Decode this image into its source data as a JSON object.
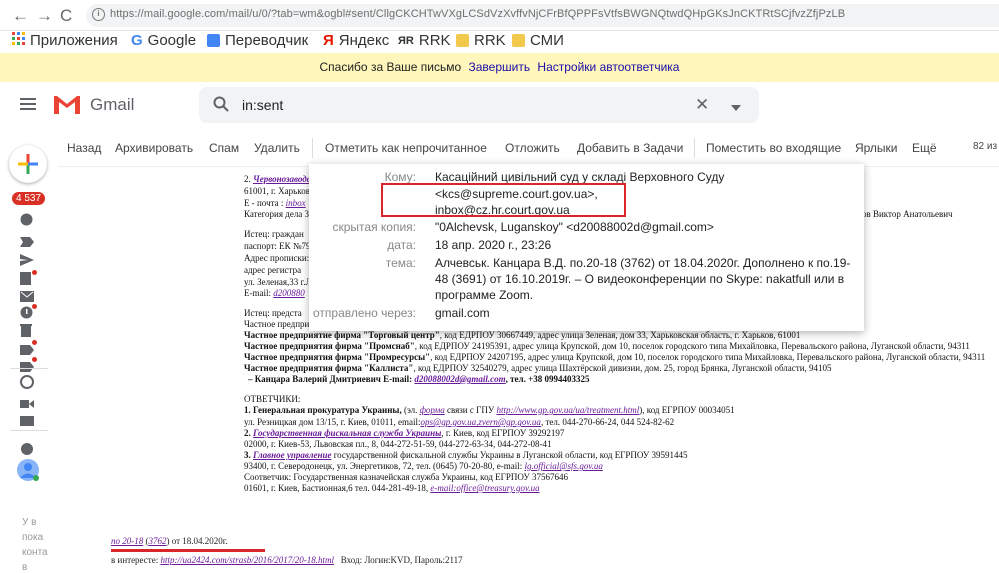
{
  "browser": {
    "url": "https://mail.google.com/mail/u/0/?tab=wm&ogbl#sent/CllgCKCHTwVXgLCSdVzXvffvNjCFrBfQPPFsVtfsBWGNQtwdQHpGKsJnCKTRtSCjfvzZfjPzLB",
    "bookmarks": [
      "Приложения",
      "Google",
      "Переводчик",
      "Яндекс",
      "RRK",
      "RRK",
      "СМИ"
    ]
  },
  "banner": {
    "text": "Спасибо за Ваше письмо",
    "link1": "Завершить",
    "link2": "Настройки автоответчика"
  },
  "header": {
    "app_name": "Gmail",
    "search_value": "in:sent"
  },
  "toolbar": {
    "back": "Назад",
    "archive": "Архивировать",
    "spam": "Спам",
    "delete": "Удалить",
    "mark_unread": "Отметить как непрочитанное",
    "snooze": "Отложить",
    "add_tasks": "Добавить в Задачи",
    "move_inbox": "Поместить во входящие",
    "labels": "Ярлыки",
    "more": "Ещё",
    "count": "82 из"
  },
  "rail": {
    "unread_badge": "4 537",
    "side_text": "У в пока конта в"
  },
  "details": {
    "to_label": "Кому:",
    "to_line1": "Касаційний цивільний суд у складі Верховного Суду",
    "to_line2": "<kcs@supreme.court.gov.ua>,",
    "to_line3": "inbox@cz.hr.court.gov.ua",
    "bcc_label": "скрытая копия:",
    "bcc_value": "\"0Alchevsk, Luganskoy\" <d20088002d@gmail.com>",
    "date_label": "дата:",
    "date_value": "18 апр. 2020 г., 23:26",
    "subject_label": "тема:",
    "subject_line1": "Алчевськ. Канцара В.Д. по.20-18 (3762) от 18.04.2020г. Дополнено к по.19-",
    "subject_line2": "48 (3691) от 16.10.2019г. – О видеоконференции по Skype: nakatfull или в",
    "subject_line3": "программе Zoom.",
    "via_label": "отправлено через:",
    "via_value": "gmail.com"
  },
  "document": {
    "l1_num": "2.",
    "l1_link": "Червонозаводс",
    "l2": "61001, г. Харьков",
    "l3_a": "Е - почта :",
    "l3_b": "inbox",
    "l4": "Категория дела 3",
    "l4_right": "ья Ежов Виктор Анатольевич",
    "l5": "Истец: граждан",
    "l6": "паспорт: ЕК №79",
    "l7": "Адрес прописки:",
    "l8": "адрес регистра",
    "l9": "ул. Зеленая,33 г.Л",
    "l10_a": "E-mail:",
    "l10_b": "d200880",
    "l11": "Истец: предста",
    "l12": "Частное предприя",
    "l13_a": "Частное предприятие фирма \"Торговый центр\"",
    "l13_b": ", код ЕДРПОУ 30667449, адрес улица Зеленая, дом 33, Харьковская область, г. Харьков, 61001",
    "l14_a": "Частное предприятия фирма \"Промснаб\"",
    "l14_b": ", код ЕДРПОУ 24195391, адрес улица Крупской, дом 10, поселок городского типа Михайловка, Перевальского района, Луганской области, 94311",
    "l15_a": "Частное предприятия фирма \"Промресурсы\"",
    "l15_b": ", код ЕДРПОУ 24207195, адрес улица Крупской, дом 10, поселок городского типа Михайловка, Перевальского района, Луганской области, 94311",
    "l16_a": "Частное предприятия фирма \"Каллиста\"",
    "l16_b": ", код ЕДРПОУ 32540279, адрес улица Шахтёрской дивизии, дом. 25, город Брянка, Луганской области, 94105",
    "l17_a": "– Канцара Валерий Дмитриевич E-mail:",
    "l17_b": "d20088002d@gmail.com",
    "l17_c": ", тел. +38 0994403325",
    "l18": "ОТВЕТЧИКИ:",
    "l19_a": "1. Генеральная прокуратура Украины,",
    "l19_b": "(эл.",
    "l19_c": "форма",
    "l19_d": "связи с ГПУ",
    "l19_e": "http://www.gp.gov.ua/ua/treatment.html",
    "l19_f": "), код ЕГРПОУ 00034051",
    "l20_a": "ул. Резницкая дом 13/15, г. Киев, 01011, email:",
    "l20_b": "ops@gp.gov.ua,zvern@gp.gov.ua",
    "l20_c": ", тел. 044-270-66-24, 044 524-82-62",
    "l21_a": "2.",
    "l21_b": "Государственная фискальная служба Украины",
    "l21_c": ", г. Киев, код ЕГРПОУ 39292197",
    "l22": "02000, г. Киев-53, Львовская пл., 8, 044-272-51-59, 044-272-63-34, 044-272-08-41",
    "l23_a": "3.",
    "l23_b": "Главное управление",
    "l23_c": "государственной фискальной службы Украины в Луганской области, код ЕГРПОУ 39591445",
    "l24_a": "93400, г. Северодонецк, ул. Энергетиков, 72, тел. (0645) 70-20-80, e-mail:",
    "l24_b": "lg.official@sfs.gov.ua",
    "l25": "Соответчик: Государственная казначейская служба Украины, код ЕГРПОУ 37567646",
    "l26_a": "01601, г. Киев, Бастионная,6 тел. 044-281-49-18,",
    "l26_b": "e-mail:office@treasury.gov.ua",
    "f1_a": "по 20-18",
    "f1_b": "(",
    "f1_c": "3762",
    "f1_d": ") от 18.04.2020г.",
    "f2_a": "в интересте:",
    "f2_b": "http://ua2424.com/strasb/2016/2017/20-18.html",
    "f2_c": "Вход: Логин:KVD, Пароль:2117"
  },
  "colors": {
    "gmail_red": "#ea4335",
    "banner_bg": "#fef6ba",
    "highlight_red": "#d8262a"
  }
}
